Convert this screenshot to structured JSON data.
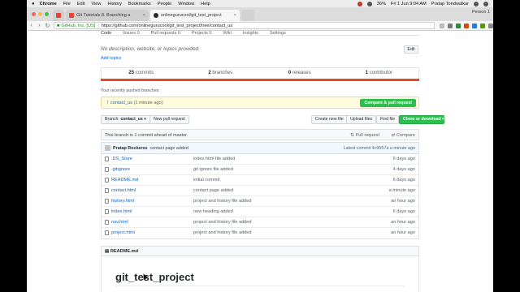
{
  "menubar": {
    "apple": "",
    "items": [
      "Chrome",
      "File",
      "Edit",
      "View",
      "History",
      "Bookmarks",
      "People",
      "Window",
      "Help"
    ],
    "battery": "36%",
    "datetime": "Fri 1 Jun  9:04 AM",
    "user": "Pratap Tondwalkar"
  },
  "tabs": [
    {
      "label": "",
      "color": "#e8412f"
    },
    {
      "label": "Git Tutorials 8. Branching a",
      "color": "#e8412f"
    },
    {
      "label": "onlinegurucool/git_test_project",
      "color": "#24292e"
    }
  ],
  "person": "Person 1",
  "address": {
    "secure_label": "GitHub, Inc. [US]",
    "url": "https://github.com/onlinegurucool/git_test_project/tree/contact_us"
  },
  "reponav": [
    "Code",
    "Issues 0",
    "Pull requests 0",
    "Projects 0",
    "Wiki",
    "Insights",
    "Settings"
  ],
  "repo": {
    "description": "No description, website, or topics provided.",
    "add_topics": "Add topics",
    "edit_label": "Edit"
  },
  "summary": {
    "commits": "25",
    "commits_label": "commits",
    "branches": "2",
    "branches_label": "branches",
    "releases": "0",
    "releases_label": "releases",
    "contributors": "1",
    "contributors_label": "contributor"
  },
  "recent": {
    "heading": "Your recently pushed branches:",
    "branch": "contact_us",
    "ago": "(1 minute ago)",
    "compare_btn": "Compare & pull request"
  },
  "actions": {
    "branch_prefix": "Branch:",
    "branch": "contact_us",
    "new_pr": "New pull request",
    "create_file": "Create new file",
    "upload": "Upload files",
    "find": "Find file",
    "clone": "Clone or download"
  },
  "ahead": {
    "message": "This branch is 1 commit ahead of master.",
    "pull_request": "Pull request",
    "compare": "Compare"
  },
  "commit": {
    "author": "Pratap Rockerss",
    "message": "contact page added",
    "latest": "Latest commit 4c9557a a minute ago"
  },
  "files": [
    {
      "name": ".DS_Store",
      "message": "index html file added",
      "age": "6 days ago"
    },
    {
      "name": ".gitignore",
      "message": "git ignore file added",
      "age": "4 days ago"
    },
    {
      "name": "README.md",
      "message": "initial commit",
      "age": "6 days ago"
    },
    {
      "name": "contact.html",
      "message": "contact page added",
      "age": "a minute ago"
    },
    {
      "name": "history.html",
      "message": "project and history file added",
      "age": "an hour ago"
    },
    {
      "name": "index.html",
      "message": "new heading added",
      "age": "6 days ago"
    },
    {
      "name": "nav.html",
      "message": "project and history file added",
      "age": "an hour ago"
    },
    {
      "name": "project.html",
      "message": "project and history file added",
      "age": "an hour ago"
    }
  ],
  "readme": {
    "header": "README.md",
    "title": "git_test_project"
  }
}
